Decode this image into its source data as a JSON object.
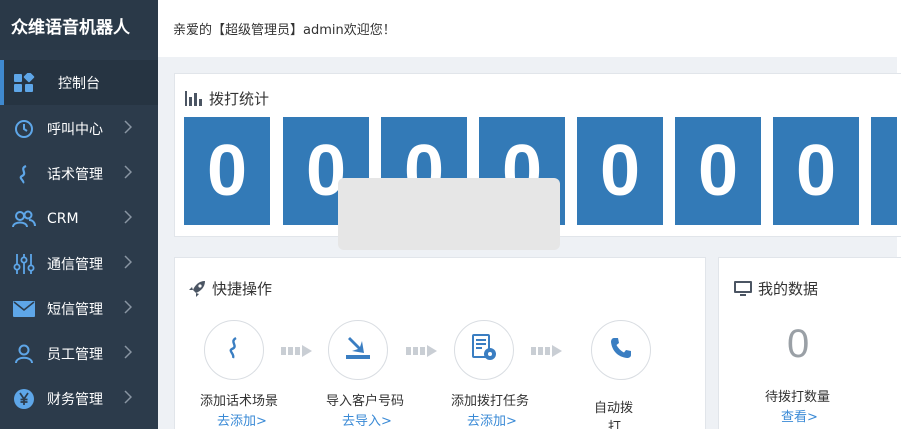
{
  "sidebar": {
    "brand": "众维语音机器人",
    "items": [
      {
        "label": "控制台"
      },
      {
        "label": "呼叫中心"
      },
      {
        "label": "话术管理"
      },
      {
        "label": "CRM"
      },
      {
        "label": "通信管理"
      },
      {
        "label": "短信管理"
      },
      {
        "label": "员工管理"
      },
      {
        "label": "财务管理"
      }
    ]
  },
  "header": {
    "welcome": "亲爱的【超级管理员】admin欢迎您！"
  },
  "stats": {
    "title": "拨打统计",
    "digits": [
      "0",
      "0",
      "0",
      "0",
      "0",
      "0",
      "0"
    ]
  },
  "quick": {
    "title": "快捷操作",
    "steps": [
      {
        "label": "添加话术场景",
        "link": "去添加>"
      },
      {
        "label": "导入客户号码",
        "link": "去导入>"
      },
      {
        "label": "添加拨打任务",
        "link": "去添加>"
      },
      {
        "label": "自动拨",
        "label2": "打"
      }
    ]
  },
  "mydata": {
    "title": "我的数据",
    "value": "0",
    "label": "待拨打数量",
    "link": "查看>"
  },
  "colors": {
    "sidebar_bg": "#2c3b4b",
    "digit_bg": "#337ab7",
    "link": "#3a8ad6",
    "active_indicator": "#3f89cf"
  }
}
